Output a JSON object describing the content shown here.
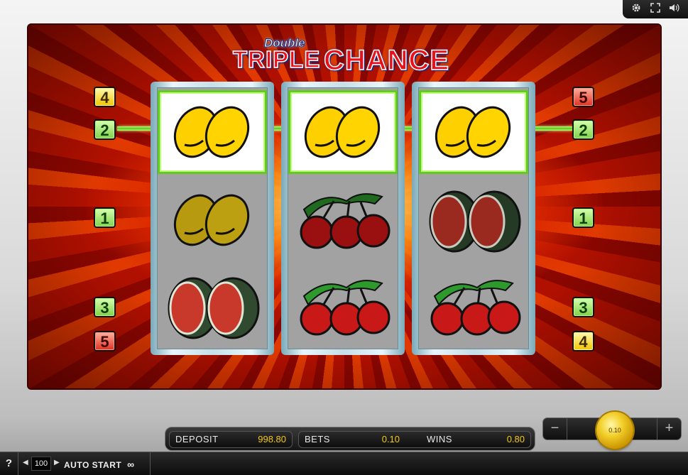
{
  "title": {
    "small": "Double",
    "word1": "TRIPLE",
    "word2": "CHANCE"
  },
  "toolbar": {
    "settings_icon": "gear-icon",
    "fullscreen_icon": "fullscreen-icon",
    "sound_icon": "speaker-icon"
  },
  "paylines": {
    "left": [
      "4",
      "2",
      "1",
      "3",
      "5"
    ],
    "right": [
      "5",
      "2",
      "1",
      "3",
      "4"
    ]
  },
  "reels": [
    {
      "symbols": [
        "lemon",
        "lemon",
        "watermelon"
      ]
    },
    {
      "symbols": [
        "lemon",
        "cherry",
        "cherry"
      ]
    },
    {
      "symbols": [
        "lemon",
        "watermelon",
        "cherry"
      ]
    }
  ],
  "winning_line": "2",
  "status": {
    "deposit_label": "DEPOSIT",
    "deposit_value": "998.80",
    "bets_label": "BETS",
    "bets_value": "0.10",
    "wins_label": "WINS",
    "wins_value": "0.80"
  },
  "bet": {
    "minus": "−",
    "plus": "+",
    "coin_value": "0.10"
  },
  "footer": {
    "help": "?",
    "autostart_count": "100",
    "autostart_label": "AUTO START",
    "infinity": "∞"
  },
  "colors": {
    "win_line": "#64c825",
    "value_text": "#f3c814",
    "badge_green": "#7fd14a",
    "badge_yellow": "#f0c400",
    "badge_red": "#e03020"
  }
}
